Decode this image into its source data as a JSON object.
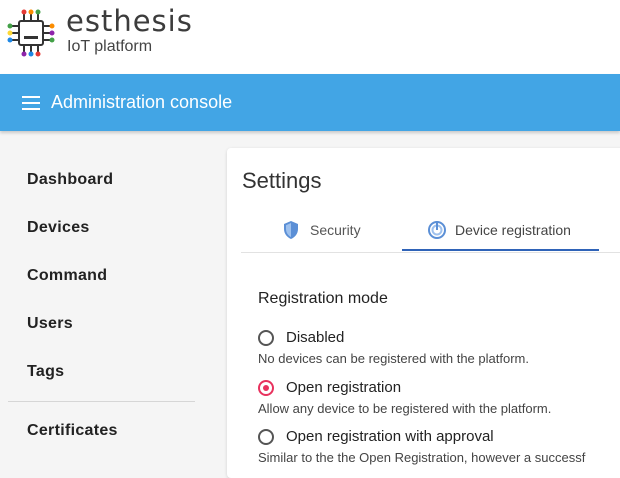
{
  "brand": {
    "name": "esthesis",
    "subtitle": "IoT platform",
    "logo_icon": "circuit-chip-icon"
  },
  "appbar": {
    "title": "Administration console",
    "menu_icon": "hamburger-menu-icon",
    "color": "#42a5e5"
  },
  "sidebar": {
    "items": [
      {
        "label": "Dashboard"
      },
      {
        "label": "Devices"
      },
      {
        "label": "Command"
      },
      {
        "label": "Users"
      },
      {
        "label": "Tags"
      },
      {
        "label": "Certificates"
      }
    ]
  },
  "settings": {
    "title": "Settings",
    "tabs": [
      {
        "label": "Security",
        "icon": "shield-icon",
        "active": false
      },
      {
        "label": "Device registration",
        "icon": "registration-icon",
        "active": true
      }
    ],
    "registration": {
      "section_title": "Registration mode",
      "options": [
        {
          "label": "Disabled",
          "description": "No devices can be registered with the platform.",
          "checked": false
        },
        {
          "label": "Open registration",
          "description": "Allow any device to be registered with the platform.",
          "checked": true
        },
        {
          "label": "Open registration with approval",
          "description": "Similar to the the Open Registration, however a successf",
          "checked": false
        }
      ]
    }
  },
  "colors": {
    "accent": "#e8325e",
    "tab_indicator": "#2f63b8"
  }
}
